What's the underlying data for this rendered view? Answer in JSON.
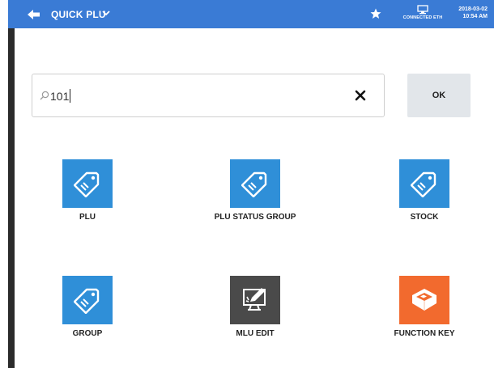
{
  "header": {
    "title": "QUICK PLU",
    "connection_label": "CONNECTED ETH",
    "date": "2018-03-02",
    "time": "10:54 AM"
  },
  "search": {
    "value": "101"
  },
  "ok_button": {
    "label": "OK"
  },
  "tiles": [
    {
      "label": "PLU",
      "icon": "tag-icon",
      "color": "#2f8fd8"
    },
    {
      "label": "PLU STATUS GROUP",
      "icon": "tag-icon",
      "color": "#2f8fd8"
    },
    {
      "label": "STOCK",
      "icon": "tag-icon",
      "color": "#2f8fd8"
    },
    {
      "label": "GROUP",
      "icon": "tag-icon",
      "color": "#2f8fd8"
    },
    {
      "label": "MLU EDIT",
      "icon": "edit-monitor-icon",
      "color": "#4a4a4a"
    },
    {
      "label": "FUNCTION KEY",
      "icon": "function-key-icon",
      "color": "#f26a2e"
    }
  ]
}
